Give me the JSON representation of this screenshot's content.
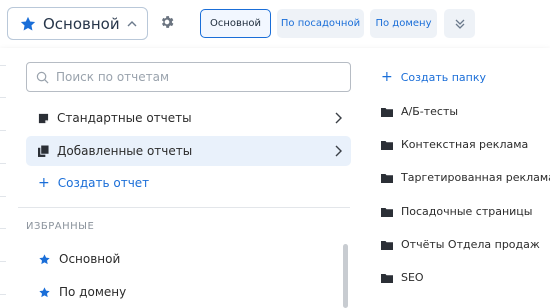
{
  "header": {
    "report_selector": {
      "label": "Основной",
      "icon": "star-icon",
      "expanded": true
    },
    "settings_icon": "gear-icon",
    "tabs": [
      {
        "label": "Основной",
        "active": true
      },
      {
        "label": "По посадочной",
        "active": false
      },
      {
        "label": "По домену",
        "active": false
      }
    ],
    "more_icon": "double-chevron-down-icon"
  },
  "dropdown": {
    "search": {
      "placeholder": "Поиск по отчетам",
      "value": ""
    },
    "categories": [
      {
        "label": "Стандартные отчеты",
        "icon": "report-icon",
        "selected": false
      },
      {
        "label": "Добавленные отчеты",
        "icon": "added-report-icon",
        "selected": true
      }
    ],
    "create_report_label": "Создать отчет",
    "favorites_heading": "ИЗБРАННЫЕ",
    "favorites": [
      {
        "label": "Основной",
        "icon": "star-icon"
      },
      {
        "label": "По домену",
        "icon": "star-icon"
      }
    ],
    "create_folder_label": "Создать папку",
    "folders": [
      {
        "label": "А/Б-тесты",
        "icon": "folder-icon"
      },
      {
        "label": "Контекстная реклама",
        "icon": "folder-icon"
      },
      {
        "label": "Таргетированная реклама",
        "icon": "folder-icon"
      },
      {
        "label": "Посадочные страницы",
        "icon": "folder-icon"
      },
      {
        "label": "Отчёты Отдела продаж",
        "icon": "folder-icon"
      },
      {
        "label": "SEO",
        "icon": "folder-icon"
      }
    ]
  },
  "colors": {
    "accent": "#1a6ed8",
    "star": "#1a6ed8",
    "selected_bg": "#e9f1fb",
    "text": "#2b2b2b",
    "muted": "#8b939c"
  }
}
